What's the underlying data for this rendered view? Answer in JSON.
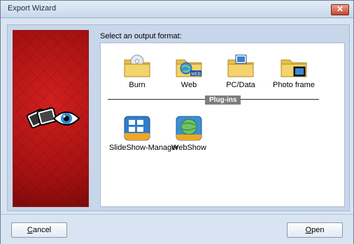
{
  "window": {
    "title": "Export Wizard",
    "close_label": "✕"
  },
  "prompt": "Select an output format:",
  "formats": [
    {
      "label": "Burn",
      "icon": "burn-folder-icon"
    },
    {
      "label": "Web",
      "icon": "web-folder-icon"
    },
    {
      "label": "PC/Data",
      "icon": "pcdata-folder-icon"
    },
    {
      "label": "Photo frame",
      "icon": "photo-frame-folder-icon"
    }
  ],
  "plugins_heading": "Plug-ins",
  "plugins": [
    {
      "label": "SlideShow-Manager",
      "icon": "slideshow-manager-icon"
    },
    {
      "label": "WebShow",
      "icon": "webshow-icon"
    }
  ],
  "buttons": {
    "cancel_first": "C",
    "cancel_rest": "ancel",
    "open_first": "O",
    "open_rest": "pen"
  },
  "colors": {
    "banner_red": "#b51414",
    "folder_yellow": "#f3d36b",
    "eye_blue": "#2a8bd6"
  }
}
